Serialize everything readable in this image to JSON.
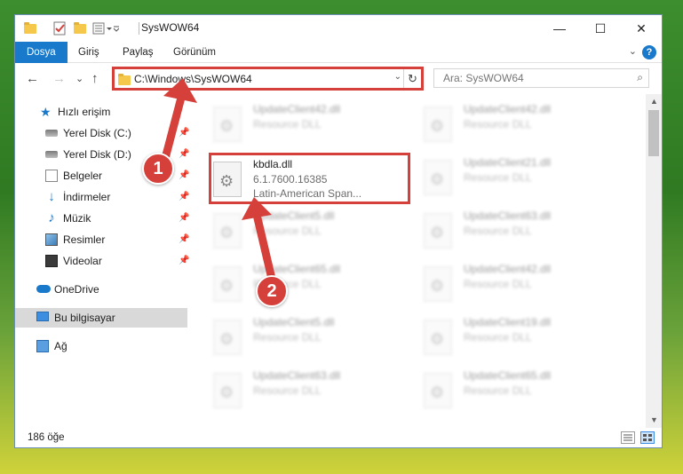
{
  "window": {
    "title": "SysWOW64",
    "controls": {
      "minimize": "—",
      "maximize": "☐",
      "close": "✕"
    }
  },
  "quick_access_toolbar": [
    "folder-icon",
    "properties-icon",
    "new-folder-icon",
    "customize-icon"
  ],
  "ribbon": {
    "tabs": [
      {
        "label": "Dosya",
        "active": true
      },
      {
        "label": "Giriş"
      },
      {
        "label": "Paylaş"
      },
      {
        "label": "Görünüm"
      }
    ],
    "expand": "⌄",
    "help": "?"
  },
  "navigation": {
    "back": "←",
    "forward": "→",
    "recent": "⌄",
    "up": "↑",
    "address": "C:\\Windows\\SysWOW64",
    "address_dropdown": "⌄",
    "refresh": "↻",
    "search_placeholder": "Ara: SysWOW64",
    "search_icon": "⌕"
  },
  "sidebar": {
    "items": [
      {
        "label": "Hızlı erişim",
        "icon": "star-icon"
      },
      {
        "label": "Yerel Disk (C:)",
        "icon": "drive-icon",
        "pinned": true
      },
      {
        "label": "Yerel Disk (D:)",
        "icon": "drive-icon",
        "pinned": true
      },
      {
        "label": "Belgeler",
        "icon": "documents-icon",
        "pinned": true
      },
      {
        "label": "İndirmeler",
        "icon": "download-icon",
        "pinned": true
      },
      {
        "label": "Müzik",
        "icon": "music-icon",
        "pinned": true
      },
      {
        "label": "Resimler",
        "icon": "pictures-icon",
        "pinned": true
      },
      {
        "label": "Videolar",
        "icon": "videos-icon",
        "pinned": true
      },
      {
        "label": "OneDrive",
        "icon": "onedrive-icon"
      },
      {
        "label": "Bu bilgisayar",
        "icon": "this-pc-icon",
        "selected": true
      },
      {
        "label": "Ağ",
        "icon": "network-icon"
      }
    ],
    "pin_glyph": "📌"
  },
  "files": {
    "column_left": [
      {
        "name": "UpdateClient42.dll",
        "type": "Resource DLL"
      },
      {
        "name": "kbdla.dll",
        "version": "6.1.7600.16385",
        "description": "Latin-American Span...",
        "highlighted": true
      },
      {
        "name": "UpdateClient5.dll",
        "type": "Resource DLL"
      },
      {
        "name": "UpdateClient65.dll",
        "type": "Resource DLL"
      },
      {
        "name": "UpdateClient5.dll",
        "type": "Resource DLL"
      },
      {
        "name": "UpdateClient63.dll",
        "type": "Resource DLL"
      }
    ],
    "column_right": [
      {
        "name": "UpdateClient42.dll",
        "type": "Resource DLL"
      },
      {
        "name": "UpdateClient21.dll",
        "type": "Resource DLL"
      },
      {
        "name": "UpdateClient63.dll",
        "type": "Resource DLL"
      },
      {
        "name": "UpdateClient42.dll",
        "type": "Resource DLL"
      },
      {
        "name": "UpdateClient19.dll",
        "type": "Resource DLL"
      },
      {
        "name": "UpdateClient65.dll",
        "type": "Resource DLL"
      }
    ],
    "gear_glyph": "⚙"
  },
  "status": {
    "item_count": "186 öğe"
  },
  "annotations": {
    "step1": "1",
    "step2": "2",
    "color": "#d6403a"
  }
}
